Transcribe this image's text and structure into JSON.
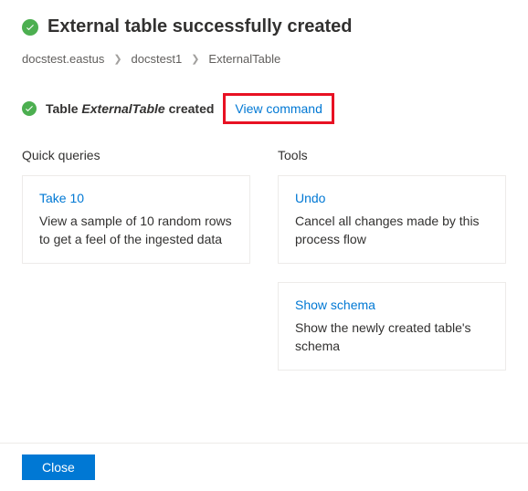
{
  "header": {
    "title": "External table successfully created"
  },
  "breadcrumb": {
    "items": [
      "docstest.eastus",
      "docstest1",
      "ExternalTable"
    ]
  },
  "status": {
    "prefix": "Table ",
    "table_name": "ExternalTable",
    "suffix": " created",
    "view_command": "View command"
  },
  "quick_queries": {
    "heading": "Quick queries",
    "cards": [
      {
        "title": "Take 10",
        "desc": "View a sample of 10 random rows to get a feel of the ingested data"
      }
    ]
  },
  "tools": {
    "heading": "Tools",
    "cards": [
      {
        "title": "Undo",
        "desc": "Cancel all changes made by this process flow"
      },
      {
        "title": "Show schema",
        "desc": "Show the newly created table's schema"
      }
    ]
  },
  "footer": {
    "close": "Close"
  }
}
